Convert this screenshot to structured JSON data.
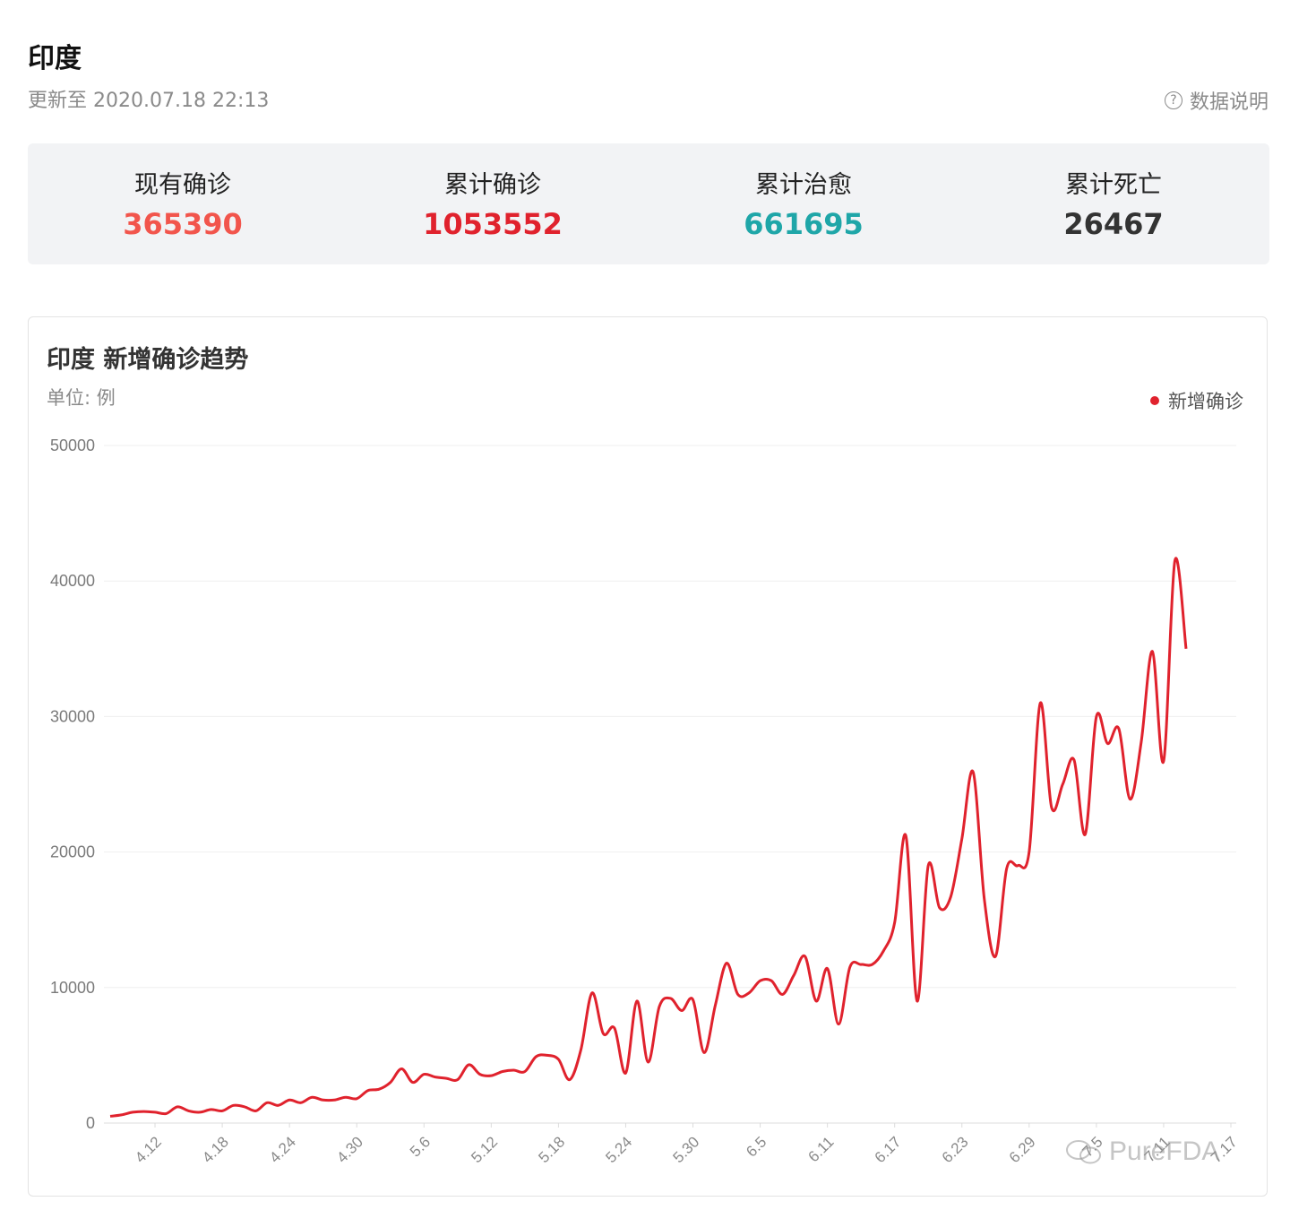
{
  "header": {
    "title": "印度",
    "updated": "更新至 2020.07.18 22:13",
    "data_note": "数据说明",
    "data_note_icon": "question-circle-icon"
  },
  "stats": [
    {
      "label": "现有确诊",
      "value": "365390",
      "color": "#f2554c"
    },
    {
      "label": "累计确诊",
      "value": "1053552",
      "color": "#e0222d"
    },
    {
      "label": "累计治愈",
      "value": "661695",
      "color": "#1fa6a8"
    },
    {
      "label": "累计死亡",
      "value": "26467",
      "color": "#333333"
    }
  ],
  "chart": {
    "title": "印度 新增确诊趋势",
    "unit": "单位: 例",
    "legend": "新增确诊",
    "watermark": "PureFDA"
  },
  "chart_data": {
    "type": "line",
    "ylim": [
      0,
      50000
    ],
    "yticks": [
      0,
      10000,
      20000,
      30000,
      40000,
      50000
    ],
    "grid": true,
    "legend_position": "top-right",
    "line_color": "#e0222d",
    "x": [
      "4.8",
      "4.9",
      "4.10",
      "4.11",
      "4.12",
      "4.13",
      "4.14",
      "4.15",
      "4.16",
      "4.17",
      "4.18",
      "4.19",
      "4.20",
      "4.21",
      "4.22",
      "4.23",
      "4.24",
      "4.25",
      "4.26",
      "4.27",
      "4.28",
      "4.29",
      "4.30",
      "5.1",
      "5.2",
      "5.3",
      "5.4",
      "5.5",
      "5.6",
      "5.7",
      "5.8",
      "5.9",
      "5.10",
      "5.11",
      "5.12",
      "5.13",
      "5.14",
      "5.15",
      "5.16",
      "5.17",
      "5.18",
      "5.19",
      "5.20",
      "5.21",
      "5.22",
      "5.23",
      "5.24",
      "5.25",
      "5.26",
      "5.27",
      "5.28",
      "5.29",
      "5.30",
      "5.31",
      "6.1",
      "6.2",
      "6.3",
      "6.4",
      "6.5",
      "6.6",
      "6.7",
      "6.8",
      "6.9",
      "6.10",
      "6.11",
      "6.12",
      "6.13",
      "6.14",
      "6.15",
      "6.16",
      "6.17",
      "6.18",
      "6.19",
      "6.20",
      "6.21",
      "6.22",
      "6.23",
      "6.24",
      "6.25",
      "6.26",
      "6.27",
      "6.28",
      "6.29",
      "6.30",
      "7.1",
      "7.2",
      "7.3",
      "7.4",
      "7.5",
      "7.6",
      "7.7",
      "7.8",
      "7.9",
      "7.10",
      "7.11",
      "7.12",
      "7.13",
      "7.14",
      "7.15",
      "7.16",
      "7.17"
    ],
    "xtick_labels": [
      "4.12",
      "4.18",
      "4.24",
      "4.30",
      "5.6",
      "5.12",
      "5.18",
      "5.24",
      "5.30",
      "6.5",
      "6.11",
      "6.17",
      "6.23",
      "6.29",
      "7.5",
      "7.11",
      "7.17"
    ],
    "series": [
      {
        "name": "新增确诊",
        "values": [
          500,
          600,
          800,
          850,
          800,
          700,
          1200,
          900,
          800,
          1000,
          900,
          1300,
          1200,
          900,
          1500,
          1300,
          1700,
          1500,
          1900,
          1700,
          1700,
          1900,
          1800,
          2400,
          2500,
          3000,
          4000,
          3000,
          3600,
          3400,
          3300,
          3200,
          4300,
          3600,
          3500,
          3800,
          3900,
          3800,
          4900,
          5000,
          4700,
          3200,
          5400,
          9600,
          6600,
          7000,
          3700,
          9000,
          4500,
          8600,
          9200,
          8300,
          9100,
          5200,
          8700,
          11800,
          9500,
          9600,
          10500,
          10500,
          9500,
          10900,
          12300,
          9000,
          11400,
          7300,
          11500,
          11700,
          11700,
          12700,
          14800,
          21200,
          9000,
          19000,
          15900,
          16700,
          21000,
          25900,
          16500,
          12300,
          18800,
          19000,
          20000,
          31000,
          23300,
          25000,
          26800,
          21300,
          30000,
          28000,
          29100,
          23900,
          28100,
          34800,
          26700,
          41500,
          35000
        ]
      }
    ]
  }
}
